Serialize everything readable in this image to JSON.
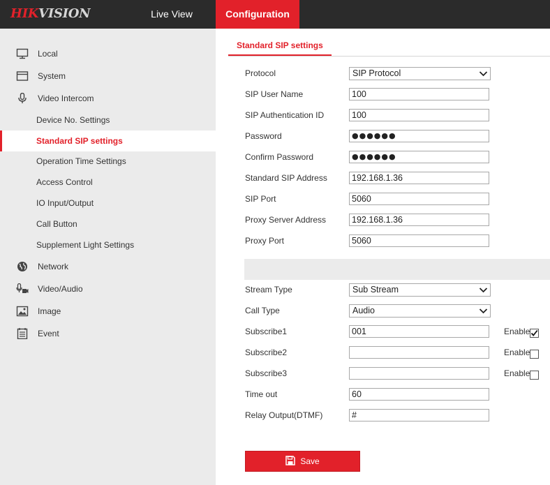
{
  "header": {
    "logo_hik": "HIK",
    "logo_rest": "VISION",
    "nav": [
      {
        "label": "Live View"
      },
      {
        "label": "Configuration"
      }
    ]
  },
  "sidebar": {
    "items": [
      {
        "label": "Local",
        "icon": "monitor-icon"
      },
      {
        "label": "System",
        "icon": "window-icon"
      },
      {
        "label": "Video Intercom",
        "icon": "microphone-icon"
      },
      {
        "label": "Device No. Settings"
      },
      {
        "label": "Standard SIP settings"
      },
      {
        "label": "Operation Time Settings"
      },
      {
        "label": "Access Control"
      },
      {
        "label": "IO Input/Output"
      },
      {
        "label": "Call Button"
      },
      {
        "label": "Supplement Light Settings"
      },
      {
        "label": "Network",
        "icon": "globe-icon"
      },
      {
        "label": "Video/Audio",
        "icon": "video-audio-icon"
      },
      {
        "label": "Image",
        "icon": "image-icon"
      },
      {
        "label": "Event",
        "icon": "event-list-icon"
      }
    ]
  },
  "main": {
    "tab": "Standard SIP settings",
    "fields": {
      "protocol": {
        "label": "Protocol",
        "value": "SIP Protocol"
      },
      "sip_user_name": {
        "label": "SIP User Name",
        "value": "100"
      },
      "sip_auth_id": {
        "label": "SIP Authentication ID",
        "value": "100"
      },
      "password": {
        "label": "Password",
        "value": "●●●●●●"
      },
      "confirm_password": {
        "label": "Confirm Password",
        "value": "●●●●●●"
      },
      "sip_address": {
        "label": "Standard SIP Address",
        "value": "192.168.1.36"
      },
      "sip_port": {
        "label": "SIP Port",
        "value": "5060"
      },
      "proxy_address": {
        "label": "Proxy Server Address",
        "value": "192.168.1.36"
      },
      "proxy_port": {
        "label": "Proxy Port",
        "value": "5060"
      },
      "stream_type": {
        "label": "Stream Type",
        "value": "Sub Stream"
      },
      "call_type": {
        "label": "Call Type",
        "value": "Audio"
      },
      "subscribe1": {
        "label": "Subscribe1",
        "value": "001",
        "enable_label": "Enable",
        "enabled": true
      },
      "subscribe2": {
        "label": "Subscribe2",
        "value": "",
        "enable_label": "Enable",
        "enabled": false
      },
      "subscribe3": {
        "label": "Subscribe3",
        "value": "",
        "enable_label": "Enable",
        "enabled": false
      },
      "time_out": {
        "label": "Time out",
        "value": "60"
      },
      "relay_output": {
        "label": "Relay Output(DTMF)",
        "value": "#"
      }
    },
    "save_label": "Save"
  },
  "colors": {
    "accent": "#e2212a",
    "header_bg": "#2b2b2b",
    "sidebar_bg": "#ebebeb"
  }
}
